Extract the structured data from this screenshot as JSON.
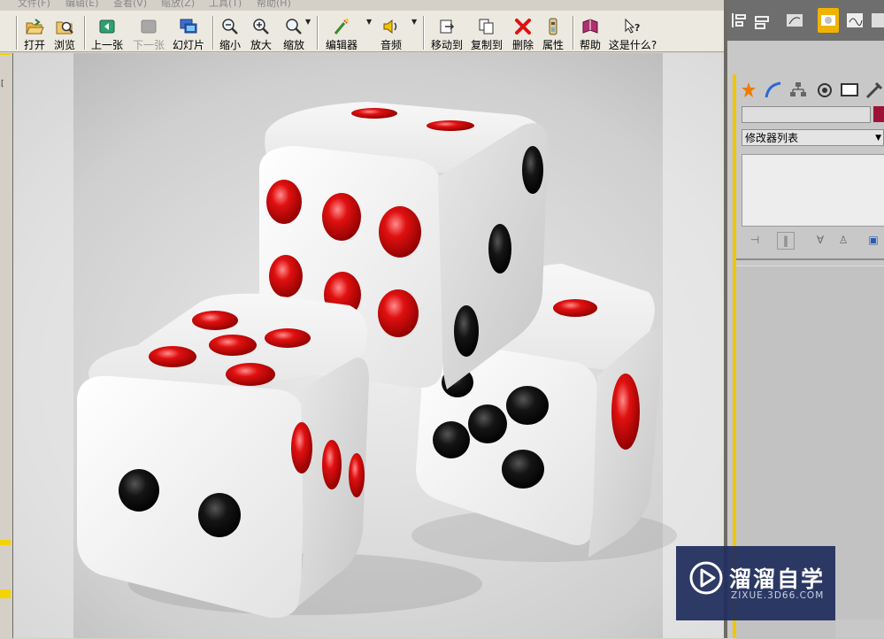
{
  "menu": [
    "文件(F)",
    "编辑(E)",
    "查看(V)",
    "缩放(Z)",
    "工具(T)",
    "帮助(H)"
  ],
  "toolbar": {
    "open": "打开",
    "browse": "浏览",
    "prev": "上一张",
    "next": "下一张",
    "slideshow": "幻灯片",
    "zoom_out": "缩小",
    "zoom_in": "放大",
    "zoom": "缩放",
    "editor": "编辑器",
    "audio": "音频",
    "move_to": "移动到",
    "copy_to": "复制到",
    "delete": "删除",
    "properties": "属性",
    "help": "帮助",
    "whats_this": "这是什么?"
  },
  "max_panel": {
    "modifier_list": "修改器列表",
    "accent_color": "#9b1337",
    "highlight": "#f2c500"
  },
  "watermark": {
    "title": "溜溜自学",
    "url": "ZIXUE.3D66.COM"
  },
  "colors": {
    "die_red": "#d40000",
    "die_black": "#111111",
    "die_white": "#f2f2f2"
  }
}
